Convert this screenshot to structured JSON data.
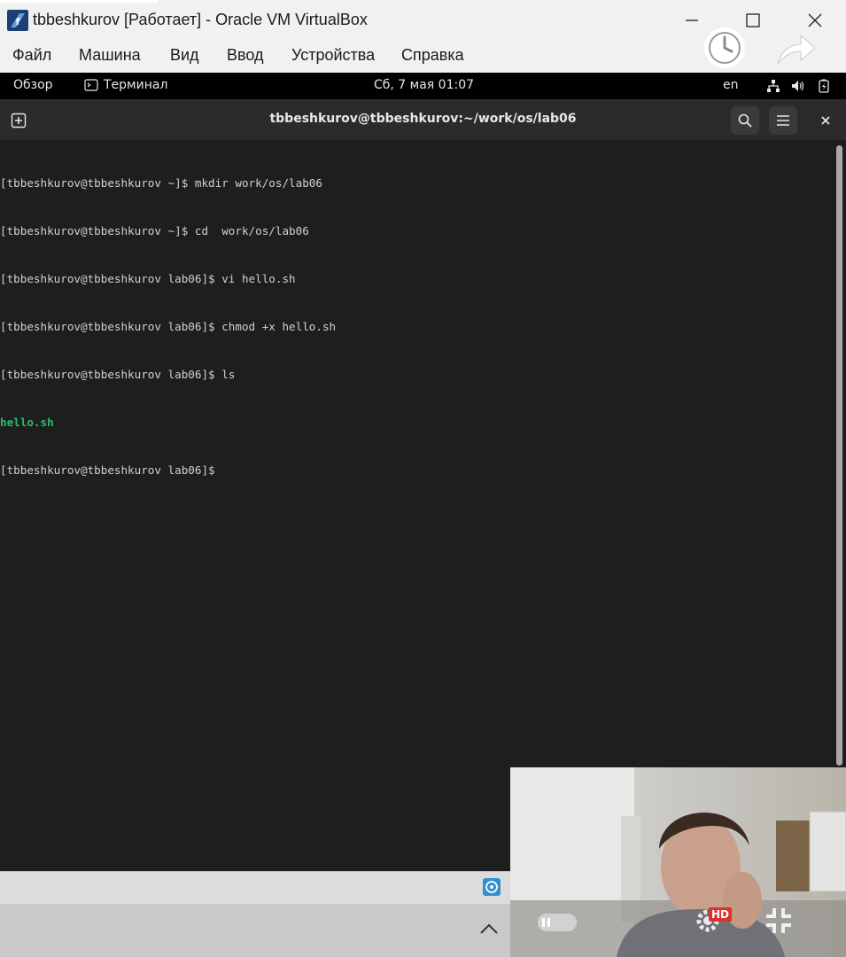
{
  "window": {
    "title": "tbbeshkurov [Работает] - Oracle VM VirtualBox",
    "menu": [
      "Файл",
      "Машина",
      "Вид",
      "Ввод",
      "Устройства",
      "Справка"
    ]
  },
  "gnome_bar": {
    "activities": "Обзор",
    "app_name": "Терминал",
    "clock": "Сб, 7 мая  01:07",
    "language": "en"
  },
  "terminal": {
    "title": "tbbeshkurov@tbbeshkurov:~/work/os/lab06",
    "lines": [
      "[tbbeshkurov@tbbeshkurov ~]$ mkdir work/os/lab06",
      "[tbbeshkurov@tbbeshkurov ~]$ cd  work/os/lab06",
      "[tbbeshkurov@tbbeshkurov lab06]$ vi hello.sh",
      "[tbbeshkurov@tbbeshkurov lab06]$ chmod +x hello.sh",
      "[tbbeshkurov@tbbeshkurov lab06]$ ls"
    ],
    "ls_output": "hello.sh",
    "current_prompt": "[tbbeshkurov@tbbeshkurov lab06]$"
  },
  "webcam": {
    "badge": "HD"
  },
  "icons": {
    "app": "virtualbox-icon",
    "minimize": "minimize-icon",
    "maximize": "maximize-icon",
    "close": "close-icon",
    "clock_overlay": "clock-icon",
    "share_overlay": "share-arrow-icon",
    "terminal_app": "terminal-icon",
    "network": "network-icon",
    "volume": "volume-icon",
    "battery": "battery-icon",
    "new_tab": "new-tab-icon",
    "search": "search-icon",
    "menu": "hamburger-menu-icon",
    "term_close": "close-icon",
    "collapse": "chevron-up-icon",
    "pause": "pause-icon",
    "settings": "gear-icon",
    "fullscreen_exit": "exit-fullscreen-icon"
  },
  "colors": {
    "terminal_bg": "#1e1e1e",
    "terminal_fg": "#d0d0d0",
    "ls_file": "#2dbb6e",
    "gnome_bar": "#000000"
  }
}
